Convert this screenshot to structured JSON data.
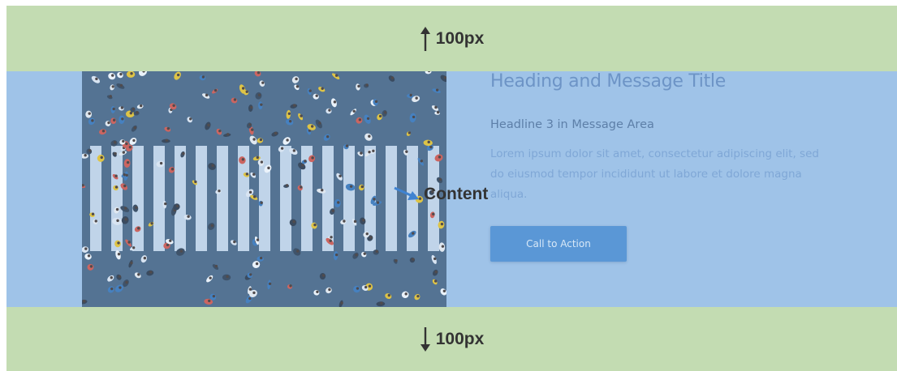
{
  "padding_top": {
    "label": "100px",
    "icon": "arrow-up-icon"
  },
  "padding_bottom": {
    "label": "100px",
    "icon": "arrow-down-icon"
  },
  "content_marker": {
    "label": "Content",
    "icon": "arrow-down-right-icon"
  },
  "hero": {
    "image": "crosswalk-crowd-aerial-photo",
    "heading": "Heading and Message Title",
    "subheading": "Headline 3 in Message Area",
    "body": "Lorem ipsum dolor sit amet, consectetur adipiscing elit, sed do eiusmod tempor incididunt ut labore et dolore magna aliqua.",
    "cta_label": "Call to Action"
  },
  "colors": {
    "padding_band": "#c3dcb2",
    "content_band": "#9fc3e8",
    "heading": "#6d94c6",
    "button": "#5a97d6",
    "label": "#333333"
  }
}
